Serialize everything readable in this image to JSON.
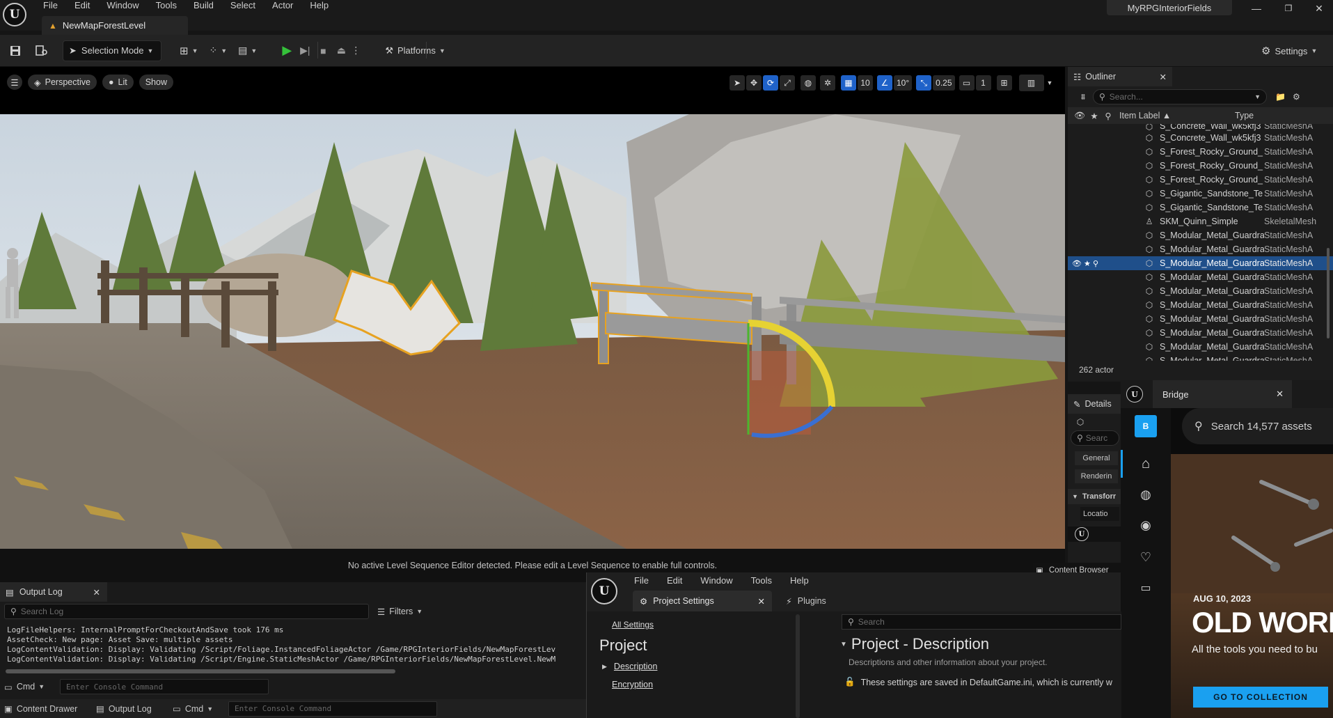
{
  "menubar": {
    "items": [
      "File",
      "Edit",
      "Window",
      "Tools",
      "Build",
      "Select",
      "Actor",
      "Help"
    ],
    "document_tab": "NewMapForestLevel",
    "project_name": "MyRPGInteriorFields",
    "win_minimize": "—",
    "win_restore": "❐",
    "win_close": "✕"
  },
  "toolbar": {
    "selection_mode": "Selection Mode",
    "platforms": "Platforms",
    "settings": "Settings"
  },
  "viewport": {
    "perspective": "Perspective",
    "lit": "Lit",
    "show": "Show",
    "grid_snap": "10",
    "rot_snap": "10°",
    "scale_snap": "0.25",
    "camera_speed": "1",
    "sequence_message": "No active Level Sequence Editor detected. Please edit a Level Sequence to enable full controls."
  },
  "outliner": {
    "tab": "Outliner",
    "search_placeholder": "Search...",
    "col_label": "Item Label",
    "col_type": "Type",
    "rows": [
      {
        "label": "S_Concrete_Wall_wk5kfj3",
        "type": "StaticMeshA",
        "selected": false
      },
      {
        "label": "S_Concrete_Wall_wk5kfj3",
        "type": "StaticMeshA",
        "selected": false
      },
      {
        "label": "S_Forest_Rocky_Ground_",
        "type": "StaticMeshA",
        "selected": false
      },
      {
        "label": "S_Forest_Rocky_Ground_",
        "type": "StaticMeshA",
        "selected": false
      },
      {
        "label": "S_Forest_Rocky_Ground_",
        "type": "StaticMeshA",
        "selected": false
      },
      {
        "label": "S_Gigantic_Sandstone_Te",
        "type": "StaticMeshA",
        "selected": false
      },
      {
        "label": "S_Gigantic_Sandstone_Te",
        "type": "StaticMeshA",
        "selected": false
      },
      {
        "label": "SKM_Quinn_Simple",
        "type": "SkeletalMesh",
        "selected": false
      },
      {
        "label": "S_Modular_Metal_Guardra",
        "type": "StaticMeshA",
        "selected": false
      },
      {
        "label": "S_Modular_Metal_Guardra",
        "type": "StaticMeshA",
        "selected": false
      },
      {
        "label": "S_Modular_Metal_Guardra",
        "type": "StaticMeshA",
        "selected": true
      },
      {
        "label": "S_Modular_Metal_Guardra",
        "type": "StaticMeshA",
        "selected": false
      },
      {
        "label": "S_Modular_Metal_Guardra",
        "type": "StaticMeshA",
        "selected": false
      },
      {
        "label": "S_Modular_Metal_Guardra",
        "type": "StaticMeshA",
        "selected": false
      },
      {
        "label": "S_Modular_Metal_Guardra",
        "type": "StaticMeshA",
        "selected": false
      },
      {
        "label": "S_Modular_Metal_Guardra",
        "type": "StaticMeshA",
        "selected": false
      },
      {
        "label": "S_Modular_Metal_Guardra",
        "type": "StaticMeshA",
        "selected": false
      },
      {
        "label": "S_Modular_Metal_Guardra",
        "type": "StaticMeshA",
        "selected": false
      }
    ],
    "actor_count": "262 actor"
  },
  "details": {
    "tab": "Details",
    "search_placeholder": "Searc",
    "general": "General",
    "rendering": "Renderin",
    "transform": "Transforr",
    "location": "Locatio",
    "content_browser": "Content Browser"
  },
  "bridge": {
    "tab": "Bridge",
    "search_placeholder": "Search 14,577 assets",
    "date": "AUG 10, 2023",
    "headline": "OLD WORKS",
    "subtitle": "All the tools you need to bu",
    "cta": "GO TO COLLECTION"
  },
  "output_log": {
    "tab": "Output Log",
    "search_placeholder": "Search Log",
    "filters": "Filters",
    "lines": [
      "LogFileHelpers: InternalPromptForCheckoutAndSave took 176 ms",
      "AssetCheck: New page: Asset Save: multiple assets",
      "LogContentValidation: Display: Validating /Script/Foliage.InstancedFoliageActor /Game/RPGInteriorFields/NewMapForestLev",
      "LogContentValidation: Display: Validating /Script/Engine.StaticMeshActor /Game/RPGInteriorFields/NewMapForestLevel.NewM"
    ],
    "cmd": "Cmd",
    "console_placeholder": "Enter Console Command"
  },
  "statusbar": {
    "content_drawer": "Content Drawer",
    "output_log": "Output Log",
    "cmd": "Cmd",
    "console_placeholder": "Enter Console Command"
  },
  "project_settings": {
    "menu": [
      "File",
      "Edit",
      "Window",
      "Tools",
      "Help"
    ],
    "tab": "Project Settings",
    "plugins_tab": "Plugins",
    "all_settings": "All Settings",
    "section": "Project",
    "nav_items": [
      "Description",
      "Encryption"
    ],
    "search_placeholder": "Search",
    "heading": "Project - Description",
    "desc": "Descriptions and other information about your project.",
    "notice": "These settings are saved in DefaultGame.ini, which is currently w"
  }
}
